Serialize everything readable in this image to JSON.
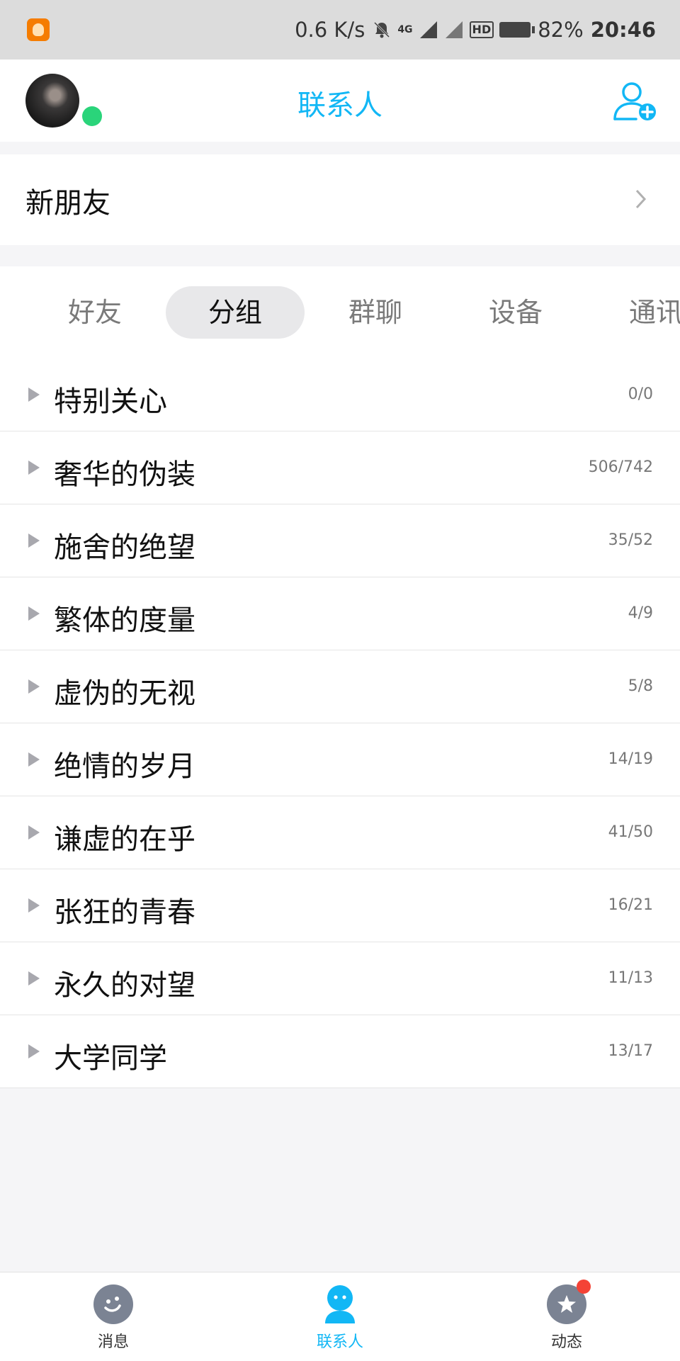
{
  "status_bar": {
    "speed": "0.6 K/s",
    "network": "4G",
    "hd": "HD",
    "battery": "82%",
    "time": "20:46"
  },
  "header": {
    "title": "联系人",
    "add_icon": "add-contact-icon",
    "online_color": "#2ad47a"
  },
  "new_friends": {
    "label": "新朋友"
  },
  "tabs": [
    {
      "label": "好友",
      "active": false
    },
    {
      "label": "分组",
      "active": true
    },
    {
      "label": "群聊",
      "active": false
    },
    {
      "label": "设备",
      "active": false
    },
    {
      "label": "通讯",
      "active": false
    }
  ],
  "groups": [
    {
      "name": "特别关心",
      "count": "0/0"
    },
    {
      "name": "奢华的伪装",
      "count": "506/742"
    },
    {
      "name": "施舍的绝望",
      "count": "35/52"
    },
    {
      "name": "繁体的度量",
      "count": "4/9"
    },
    {
      "name": "虚伪的无视",
      "count": "5/8"
    },
    {
      "name": "绝情的岁月",
      "count": "14/19"
    },
    {
      "name": "谦虚的在乎",
      "count": "41/50"
    },
    {
      "name": "张狂的青春",
      "count": "16/21"
    },
    {
      "name": "永久的对望",
      "count": "11/13"
    },
    {
      "name": "大学同学",
      "count": "13/17"
    }
  ],
  "bottom_nav": [
    {
      "label": "消息",
      "icon": "message-icon",
      "active": false
    },
    {
      "label": "联系人",
      "icon": "contacts-icon",
      "active": true
    },
    {
      "label": "动态",
      "icon": "star-icon",
      "active": false,
      "badge": true
    }
  ],
  "colors": {
    "accent": "#12b7f5",
    "badge": "#f44336"
  }
}
